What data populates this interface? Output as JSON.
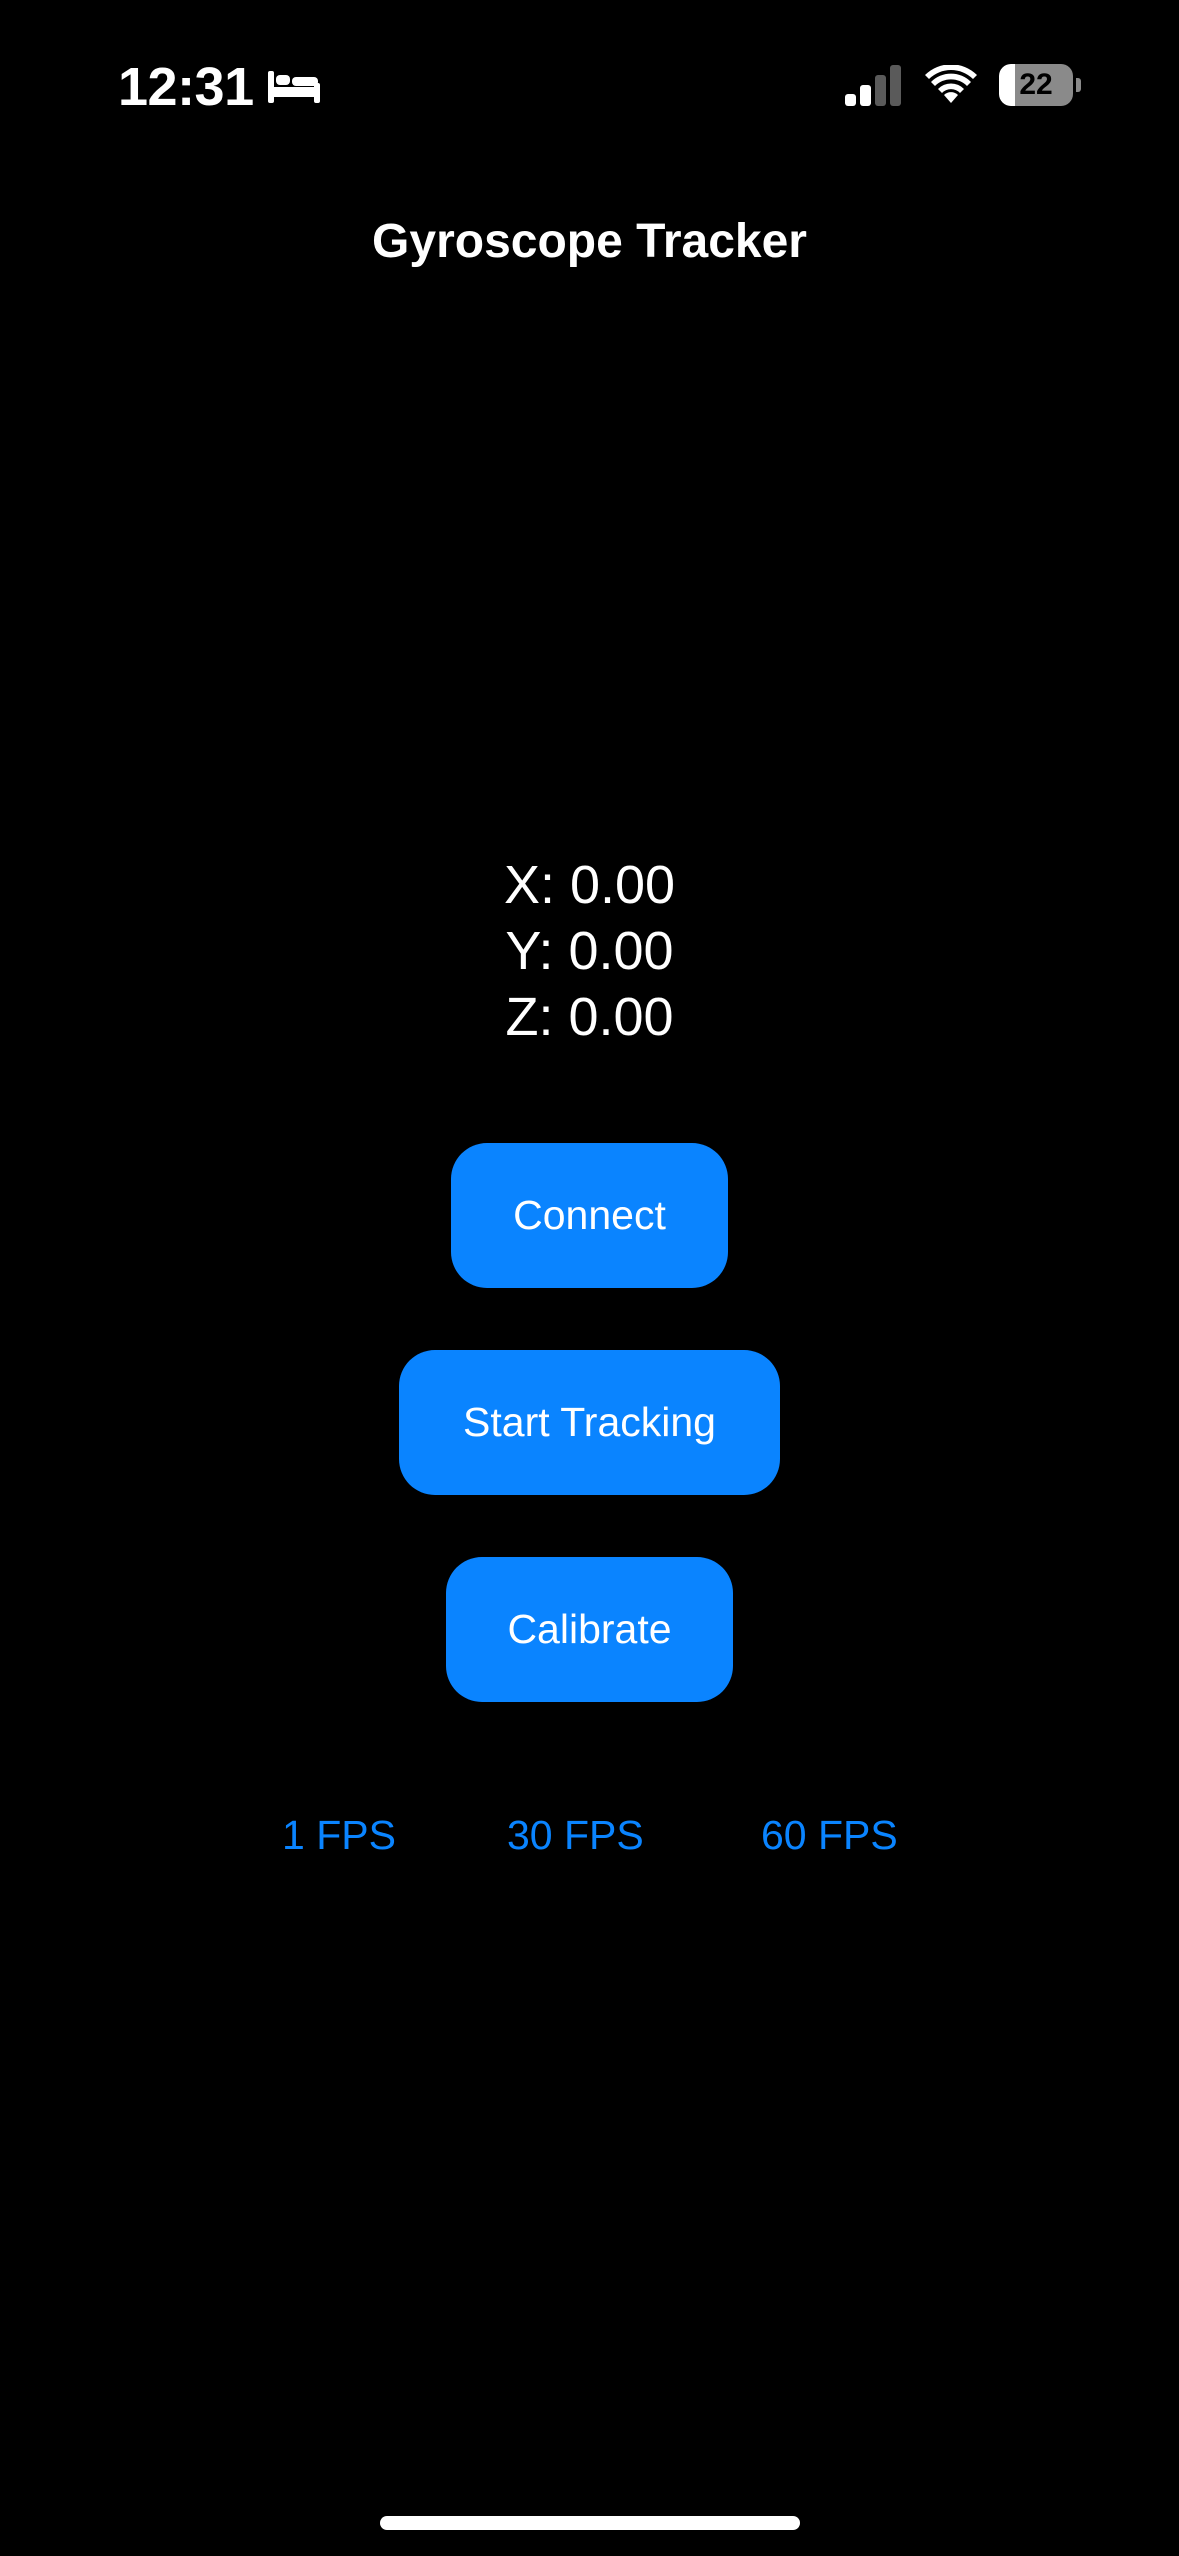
{
  "status_bar": {
    "time": "12:31",
    "focus_icon": "bed-icon",
    "signal_icon": "cellular-signal-icon",
    "signal_bars_active": 2,
    "signal_bars_total": 4,
    "wifi_icon": "wifi-icon",
    "battery_percent": "22",
    "battery_level": 0.22
  },
  "app": {
    "title": "Gyroscope Tracker"
  },
  "readouts": {
    "x": "X: 0.00",
    "y": "Y: 0.00",
    "z": "Z: 0.00"
  },
  "buttons": {
    "connect": "Connect",
    "start_tracking": "Start Tracking",
    "calibrate": "Calibrate"
  },
  "fps_options": [
    "1 FPS",
    "30 FPS",
    "60 FPS"
  ],
  "colors": {
    "background": "#000000",
    "accent": "#0a84ff",
    "text": "#ffffff"
  }
}
